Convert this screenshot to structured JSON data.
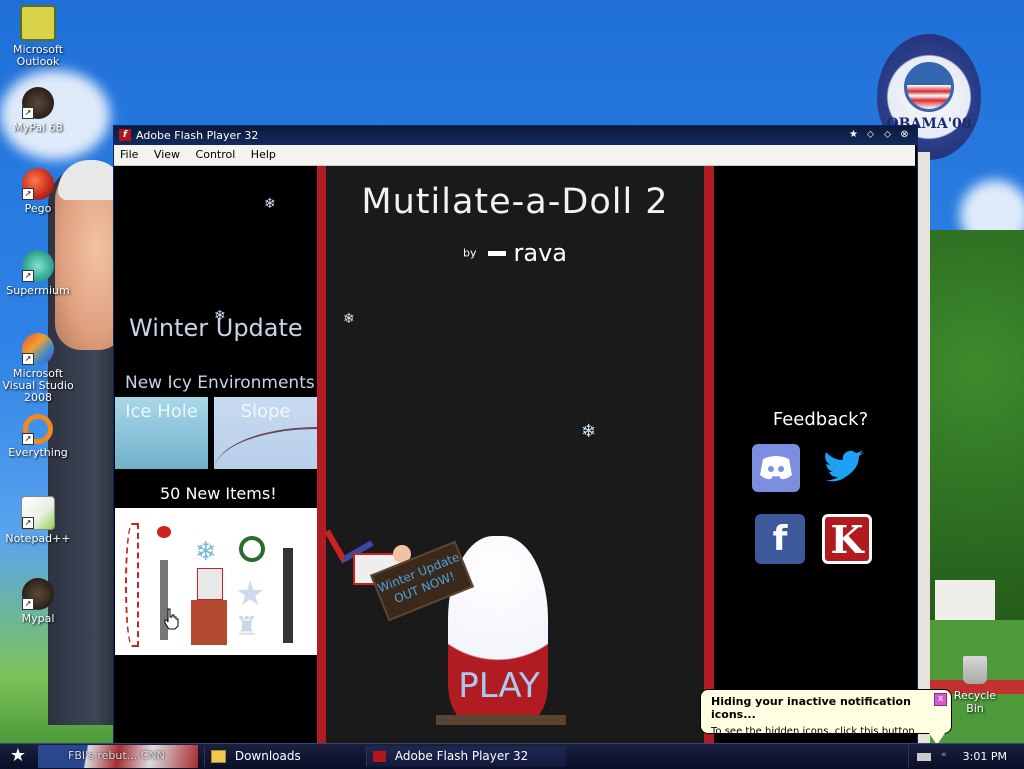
{
  "desktop": {
    "icons": [
      {
        "label": "Microsoft Outlook",
        "icon": "outlook-icon",
        "shortcut": false
      },
      {
        "label": "MyPal 68",
        "icon": "mypal-icon",
        "shortcut": true
      },
      {
        "label": "Pego",
        "icon": "pego-icon",
        "shortcut": true
      },
      {
        "label": "Supermium",
        "icon": "supermium-icon",
        "shortcut": true
      },
      {
        "label": "Microsoft Visual Studio 2008",
        "icon": "visual-studio-icon",
        "shortcut": true
      },
      {
        "label": "Everything",
        "icon": "everything-icon",
        "shortcut": true
      },
      {
        "label": "Notepad++",
        "icon": "notepadpp-icon",
        "shortcut": true
      },
      {
        "label": "Mypal",
        "icon": "mypal-icon",
        "shortcut": true
      }
    ],
    "recycle_bin_label": "Recycle Bin",
    "poster": {
      "text": "OBAMA'08"
    }
  },
  "window": {
    "title": "Adobe Flash Player 32",
    "menu": [
      "File",
      "View",
      "Control",
      "Help"
    ]
  },
  "game": {
    "title": "Mutilate-a-Doll 2",
    "by": "by",
    "author": "rava",
    "winter_update": "Winter Update",
    "new_environments": "New Icy Environments!",
    "environments": [
      {
        "label": "Ice Hole"
      },
      {
        "label": "Slope"
      }
    ],
    "new_items": "50 New Items!",
    "sign_line1": "Winter Update",
    "sign_line2": "OUT NOW!",
    "play": "PLAY",
    "feedback": "Feedback?",
    "social": [
      "Discord",
      "Twitter",
      "Facebook",
      "Kongregate"
    ],
    "kong_letter": "K",
    "facebook_letter": "f"
  },
  "taskbar": {
    "start_glyph": "★",
    "pinned_text": "FBI's rebut... CNN",
    "tasks": [
      {
        "label": "Downloads",
        "icon": "folder-icon"
      },
      {
        "label": "Adobe Flash Player 32",
        "icon": "flash-icon"
      }
    ],
    "clock": "3:01 PM"
  },
  "balloon": {
    "title": "Hiding your inactive notification icons...",
    "body": "To see the hidden icons, click this button.",
    "close": "x"
  },
  "colors": {
    "flash_red": "#b01c22",
    "title_blue": "#132a5e",
    "balloon_bg": "#ffffe1"
  }
}
